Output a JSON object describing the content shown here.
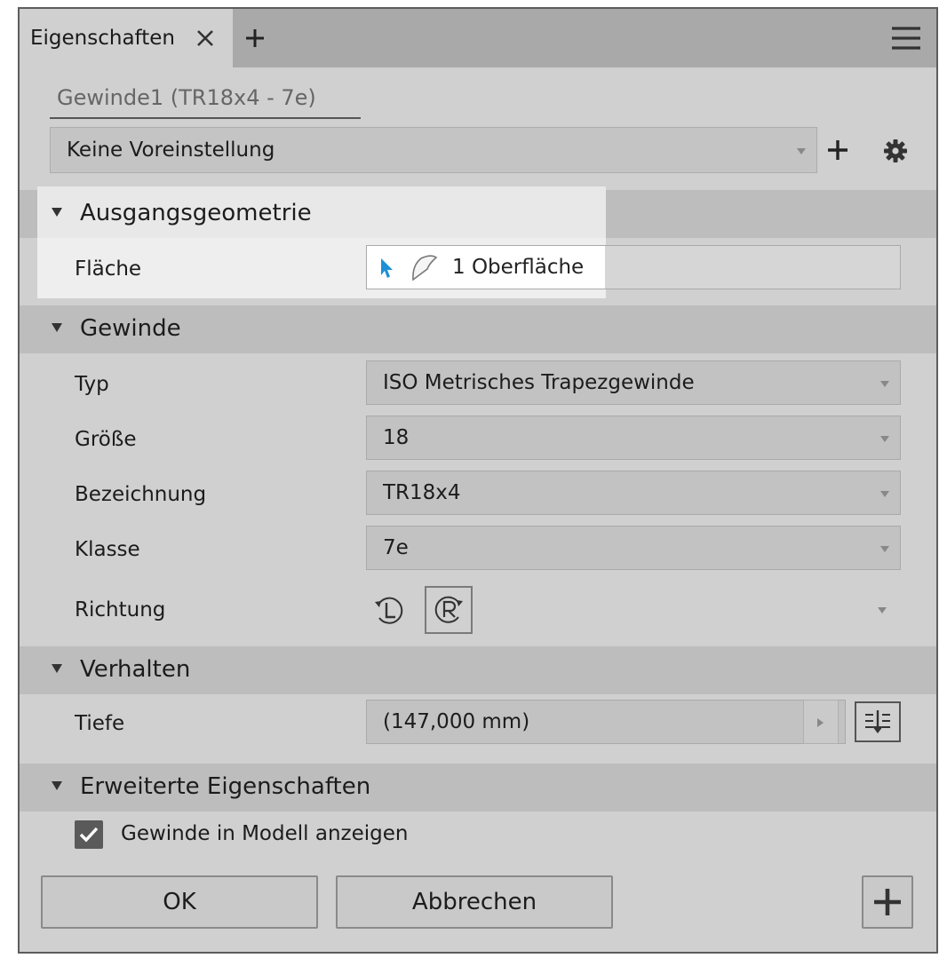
{
  "tab": {
    "title": "Eigenschaften",
    "close_icon": "close-icon",
    "add_icon": "plus-icon"
  },
  "menu_icon": "hamburger-menu-icon",
  "feature_name": "Gewinde1 (TR18x4 - 7e)",
  "preset": {
    "value": "Keine Voreinstellung",
    "add_icon": "plus-icon",
    "settings_icon": "gear-icon"
  },
  "sections": {
    "input_geometry": {
      "title": "Ausgangsgeometrie",
      "face_label": "Fläche",
      "face_value": "1 Oberfläche"
    },
    "thread": {
      "title": "Gewinde",
      "type_label": "Typ",
      "type_value": "ISO Metrisches Trapezgewinde",
      "size_label": "Größe",
      "size_value": "18",
      "designation_label": "Bezeichnung",
      "designation_value": "TR18x4",
      "class_label": "Klasse",
      "class_value": "7e",
      "direction_label": "Richtung"
    },
    "behavior": {
      "title": "Verhalten",
      "depth_label": "Tiefe",
      "depth_value": "(147,000 mm)"
    },
    "advanced": {
      "title": "Erweiterte Eigenschaften",
      "show_in_model_label": "Gewinde in Modell anzeigen",
      "show_in_model_checked": true
    }
  },
  "buttons": {
    "ok": "OK",
    "cancel": "Abbrechen"
  },
  "colors": {
    "highlight": "#e8e8e8",
    "accent_blue": "#1e8fd6",
    "panel_bg": "#d0d0d0",
    "section_bg": "#bdbdbd"
  }
}
